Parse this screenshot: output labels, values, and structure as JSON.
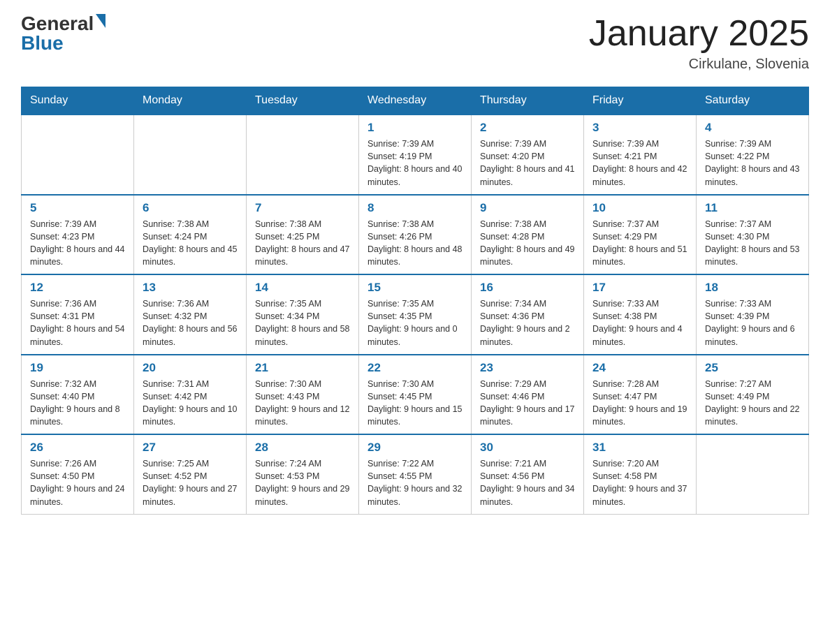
{
  "header": {
    "logo_general": "General",
    "logo_blue": "Blue",
    "title": "January 2025",
    "subtitle": "Cirkulane, Slovenia"
  },
  "days_of_week": [
    "Sunday",
    "Monday",
    "Tuesday",
    "Wednesday",
    "Thursday",
    "Friday",
    "Saturday"
  ],
  "weeks": [
    [
      {
        "day": "",
        "sunrise": "",
        "sunset": "",
        "daylight": ""
      },
      {
        "day": "",
        "sunrise": "",
        "sunset": "",
        "daylight": ""
      },
      {
        "day": "",
        "sunrise": "",
        "sunset": "",
        "daylight": ""
      },
      {
        "day": "1",
        "sunrise": "Sunrise: 7:39 AM",
        "sunset": "Sunset: 4:19 PM",
        "daylight": "Daylight: 8 hours and 40 minutes."
      },
      {
        "day": "2",
        "sunrise": "Sunrise: 7:39 AM",
        "sunset": "Sunset: 4:20 PM",
        "daylight": "Daylight: 8 hours and 41 minutes."
      },
      {
        "day": "3",
        "sunrise": "Sunrise: 7:39 AM",
        "sunset": "Sunset: 4:21 PM",
        "daylight": "Daylight: 8 hours and 42 minutes."
      },
      {
        "day": "4",
        "sunrise": "Sunrise: 7:39 AM",
        "sunset": "Sunset: 4:22 PM",
        "daylight": "Daylight: 8 hours and 43 minutes."
      }
    ],
    [
      {
        "day": "5",
        "sunrise": "Sunrise: 7:39 AM",
        "sunset": "Sunset: 4:23 PM",
        "daylight": "Daylight: 8 hours and 44 minutes."
      },
      {
        "day": "6",
        "sunrise": "Sunrise: 7:38 AM",
        "sunset": "Sunset: 4:24 PM",
        "daylight": "Daylight: 8 hours and 45 minutes."
      },
      {
        "day": "7",
        "sunrise": "Sunrise: 7:38 AM",
        "sunset": "Sunset: 4:25 PM",
        "daylight": "Daylight: 8 hours and 47 minutes."
      },
      {
        "day": "8",
        "sunrise": "Sunrise: 7:38 AM",
        "sunset": "Sunset: 4:26 PM",
        "daylight": "Daylight: 8 hours and 48 minutes."
      },
      {
        "day": "9",
        "sunrise": "Sunrise: 7:38 AM",
        "sunset": "Sunset: 4:28 PM",
        "daylight": "Daylight: 8 hours and 49 minutes."
      },
      {
        "day": "10",
        "sunrise": "Sunrise: 7:37 AM",
        "sunset": "Sunset: 4:29 PM",
        "daylight": "Daylight: 8 hours and 51 minutes."
      },
      {
        "day": "11",
        "sunrise": "Sunrise: 7:37 AM",
        "sunset": "Sunset: 4:30 PM",
        "daylight": "Daylight: 8 hours and 53 minutes."
      }
    ],
    [
      {
        "day": "12",
        "sunrise": "Sunrise: 7:36 AM",
        "sunset": "Sunset: 4:31 PM",
        "daylight": "Daylight: 8 hours and 54 minutes."
      },
      {
        "day": "13",
        "sunrise": "Sunrise: 7:36 AM",
        "sunset": "Sunset: 4:32 PM",
        "daylight": "Daylight: 8 hours and 56 minutes."
      },
      {
        "day": "14",
        "sunrise": "Sunrise: 7:35 AM",
        "sunset": "Sunset: 4:34 PM",
        "daylight": "Daylight: 8 hours and 58 minutes."
      },
      {
        "day": "15",
        "sunrise": "Sunrise: 7:35 AM",
        "sunset": "Sunset: 4:35 PM",
        "daylight": "Daylight: 9 hours and 0 minutes."
      },
      {
        "day": "16",
        "sunrise": "Sunrise: 7:34 AM",
        "sunset": "Sunset: 4:36 PM",
        "daylight": "Daylight: 9 hours and 2 minutes."
      },
      {
        "day": "17",
        "sunrise": "Sunrise: 7:33 AM",
        "sunset": "Sunset: 4:38 PM",
        "daylight": "Daylight: 9 hours and 4 minutes."
      },
      {
        "day": "18",
        "sunrise": "Sunrise: 7:33 AM",
        "sunset": "Sunset: 4:39 PM",
        "daylight": "Daylight: 9 hours and 6 minutes."
      }
    ],
    [
      {
        "day": "19",
        "sunrise": "Sunrise: 7:32 AM",
        "sunset": "Sunset: 4:40 PM",
        "daylight": "Daylight: 9 hours and 8 minutes."
      },
      {
        "day": "20",
        "sunrise": "Sunrise: 7:31 AM",
        "sunset": "Sunset: 4:42 PM",
        "daylight": "Daylight: 9 hours and 10 minutes."
      },
      {
        "day": "21",
        "sunrise": "Sunrise: 7:30 AM",
        "sunset": "Sunset: 4:43 PM",
        "daylight": "Daylight: 9 hours and 12 minutes."
      },
      {
        "day": "22",
        "sunrise": "Sunrise: 7:30 AM",
        "sunset": "Sunset: 4:45 PM",
        "daylight": "Daylight: 9 hours and 15 minutes."
      },
      {
        "day": "23",
        "sunrise": "Sunrise: 7:29 AM",
        "sunset": "Sunset: 4:46 PM",
        "daylight": "Daylight: 9 hours and 17 minutes."
      },
      {
        "day": "24",
        "sunrise": "Sunrise: 7:28 AM",
        "sunset": "Sunset: 4:47 PM",
        "daylight": "Daylight: 9 hours and 19 minutes."
      },
      {
        "day": "25",
        "sunrise": "Sunrise: 7:27 AM",
        "sunset": "Sunset: 4:49 PM",
        "daylight": "Daylight: 9 hours and 22 minutes."
      }
    ],
    [
      {
        "day": "26",
        "sunrise": "Sunrise: 7:26 AM",
        "sunset": "Sunset: 4:50 PM",
        "daylight": "Daylight: 9 hours and 24 minutes."
      },
      {
        "day": "27",
        "sunrise": "Sunrise: 7:25 AM",
        "sunset": "Sunset: 4:52 PM",
        "daylight": "Daylight: 9 hours and 27 minutes."
      },
      {
        "day": "28",
        "sunrise": "Sunrise: 7:24 AM",
        "sunset": "Sunset: 4:53 PM",
        "daylight": "Daylight: 9 hours and 29 minutes."
      },
      {
        "day": "29",
        "sunrise": "Sunrise: 7:22 AM",
        "sunset": "Sunset: 4:55 PM",
        "daylight": "Daylight: 9 hours and 32 minutes."
      },
      {
        "day": "30",
        "sunrise": "Sunrise: 7:21 AM",
        "sunset": "Sunset: 4:56 PM",
        "daylight": "Daylight: 9 hours and 34 minutes."
      },
      {
        "day": "31",
        "sunrise": "Sunrise: 7:20 AM",
        "sunset": "Sunset: 4:58 PM",
        "daylight": "Daylight: 9 hours and 37 minutes."
      },
      {
        "day": "",
        "sunrise": "",
        "sunset": "",
        "daylight": ""
      }
    ]
  ]
}
